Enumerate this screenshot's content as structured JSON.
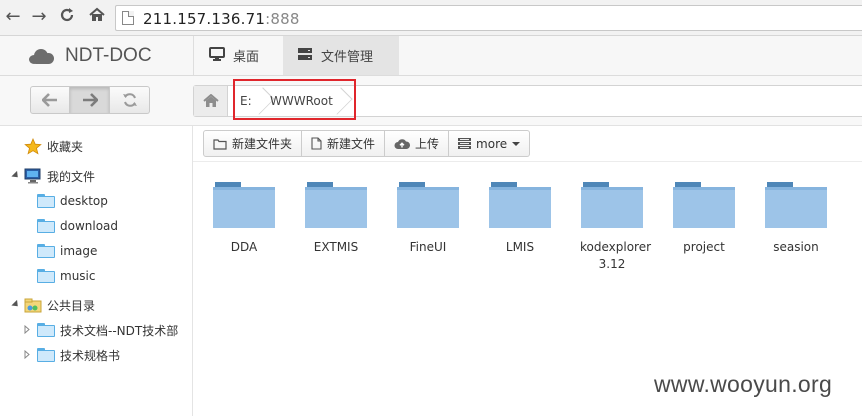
{
  "browser": {
    "url_host": "211.157.136.71",
    "url_port": ":888"
  },
  "app": {
    "title": "NDT-DOC",
    "tabs": [
      {
        "label": "桌面"
      },
      {
        "label": "文件管理"
      }
    ]
  },
  "path": {
    "crumbs": [
      "E:",
      "WWWRoot"
    ]
  },
  "sidebar": {
    "favorites": "收藏夹",
    "my_files": "我的文件",
    "my_children": [
      "desktop",
      "download",
      "image",
      "music"
    ],
    "public": "公共目录",
    "public_children": [
      "技术文档--NDT技术部",
      "技术规格书"
    ]
  },
  "toolbar": {
    "new_folder": "新建文件夹",
    "new_file": "新建文件",
    "upload": "上传",
    "more": "more"
  },
  "files": [
    {
      "name": "DDA"
    },
    {
      "name": "EXTMIS"
    },
    {
      "name": "FineUI"
    },
    {
      "name": "LMIS"
    },
    {
      "name": "kodexplorer 3.12"
    },
    {
      "name": "project"
    },
    {
      "name": "seasion"
    }
  ],
  "watermark": "www.wooyun.org",
  "colors": {
    "folder_tab": "#4f87b8",
    "folder_body": "#9dc4e8",
    "highlight_box": "#e0262c"
  }
}
